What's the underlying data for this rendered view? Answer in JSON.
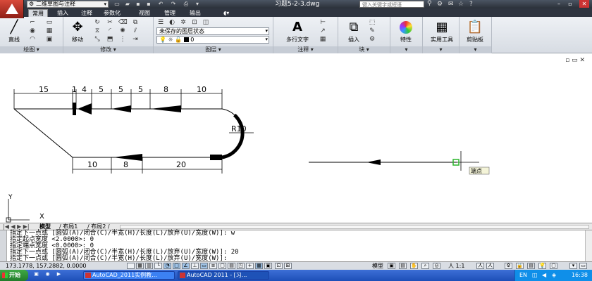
{
  "title_bar": {
    "workspace": "二维草图与注释",
    "doc_title": "习题5-2-3.dwg",
    "search_placeholder": "键入关键字或短语"
  },
  "ribbon_tabs": [
    "常用",
    "插入",
    "注释",
    "参数化",
    "视图",
    "管理",
    "输出"
  ],
  "ribbon": {
    "draw": {
      "title": "绘图",
      "line_label": "直线"
    },
    "modify": {
      "title": "修改",
      "move_label": "移动"
    },
    "layers": {
      "title": "图层",
      "layer_state": "未保存的图层状态",
      "current_layer": "0"
    },
    "annotation": {
      "title": "注释",
      "mtext_label": "多行文字"
    },
    "block": {
      "title": "块",
      "insert_label": "插入"
    },
    "properties": {
      "label": "特性"
    },
    "utilities": {
      "label": "实用工具"
    },
    "clipboard": {
      "label": "剪贴板"
    }
  },
  "drawing": {
    "dims_top": [
      "15",
      "1",
      "4",
      "5",
      "5",
      "5",
      "8",
      "10"
    ],
    "dims_bottom": [
      "10",
      "8",
      "20"
    ],
    "radius_label": "R10",
    "osnap_tooltip": "端点",
    "ucs_x": "X",
    "ucs_y": "Y"
  },
  "layout_tabs": [
    "模型",
    "布局1",
    "布局2"
  ],
  "command_lines": [
    "指定下一点或 [圆弧(A)/闭合(C)/半宽(H)/长度(L)/放弃(U)/宽度(W)]: w",
    "指定起点宽度 <2.0000>: 0",
    "指定端点宽度 <0.0000>: 0",
    "指定下一点或 [圆弧(A)/闭合(C)/半宽(H)/长度(L)/放弃(U)/宽度(W)]: 20",
    "指定下一点或 [圆弧(A)/闭合(C)/半宽(H)/长度(L)/放弃(U)/宽度(W)]:"
  ],
  "status_bar": {
    "coords": "173.1778, 157.2882, 0.0000",
    "model_label": "模型",
    "scale": "人 1:1"
  },
  "taskbar": {
    "start_label": "开始",
    "tasks": [
      "AutoCAD_2011实例教...",
      "AutoCAD 2011 - [习..."
    ],
    "clock": "16:38"
  }
}
